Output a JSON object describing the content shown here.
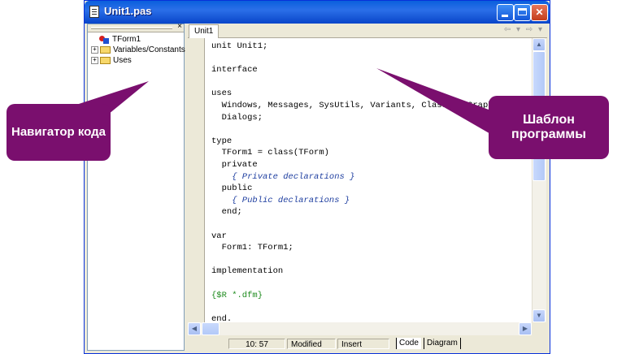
{
  "window": {
    "title": "Unit1.pas"
  },
  "explorer": {
    "close_label": "×",
    "items": [
      {
        "label": "TForm1",
        "expander": ""
      },
      {
        "label": "Variables/Constants",
        "expander": "+"
      },
      {
        "label": "Uses",
        "expander": "+"
      }
    ]
  },
  "editor": {
    "tab_label": "Unit1",
    "nav_arrows": "⇦ ▾ ⇨ ▾",
    "code_lines": [
      "unit Unit1;",
      "",
      "interface",
      "",
      "uses",
      "  Windows, Messages, SysUtils, Variants, Classes, Graphics, Controls, Forms,",
      "  Dialogs;",
      "",
      "type",
      "  TForm1 = class(TForm)",
      "  private",
      "    { Private declarations }",
      "  public",
      "    { Public declarations }",
      "  end;",
      "",
      "var",
      "  Form1: TForm1;",
      "",
      "implementation",
      "",
      "{$R *.dfm}",
      "",
      "end."
    ]
  },
  "status": {
    "position": "10: 57",
    "modified": "Modified",
    "mode": "Insert",
    "tab_code": "Code",
    "tab_diagram": "Diagram"
  },
  "callouts": {
    "left": "Навигатор кода",
    "right": "Шаблон программы"
  },
  "colors": {
    "title_bar": "#0a5fdc",
    "callout": "#7a0f6e",
    "comment": "#1f3fa0",
    "directive": "#1c8a1c"
  }
}
